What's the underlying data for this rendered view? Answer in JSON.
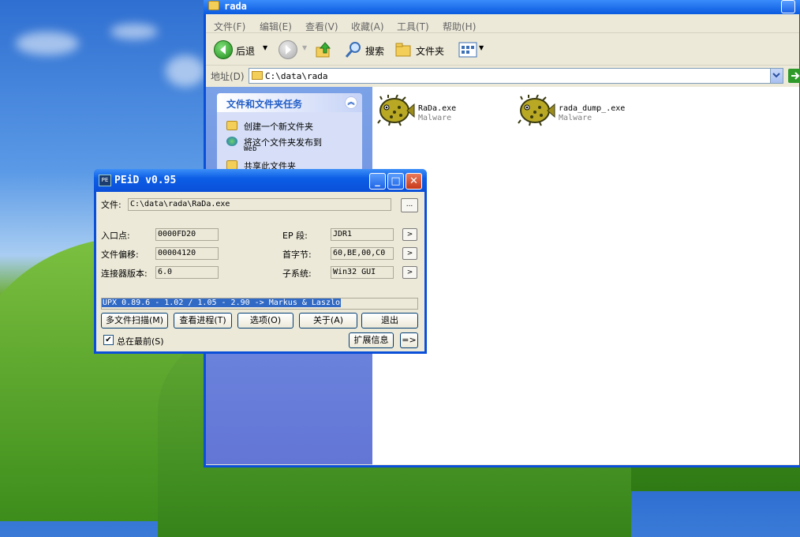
{
  "explorer": {
    "title": "rada",
    "menu": [
      "文件(F)",
      "编辑(E)",
      "查看(V)",
      "收藏(A)",
      "工具(T)",
      "帮助(H)"
    ],
    "toolbar": {
      "back": "后退",
      "search": "搜索",
      "folders": "文件夹"
    },
    "address_label": "地址(D)",
    "address_value": "C:\\data\\rada",
    "tasks_header": "文件和文件夹任务",
    "tasks": [
      "创建一个新文件夹",
      "将这个文件夹发布到",
      "Web",
      "共享此文件夹"
    ],
    "files": [
      {
        "name": "RaDa.exe",
        "type": "Malware"
      },
      {
        "name": "rada_dump_.exe",
        "type": "Malware"
      }
    ]
  },
  "peid": {
    "title": "PEiD v0.95",
    "file_label": "文件:",
    "file_value": "C:\\data\\rada\\RaDa.exe",
    "browse": "...",
    "entry_label": "入口点:",
    "entry_value": "0000FD20",
    "offset_label": "文件偏移:",
    "offset_value": "00004120",
    "linker_label": "连接器版本:",
    "linker_value": "6.0",
    "ep_label": "EP 段:",
    "ep_value": "JDR1",
    "firstbytes_label": "首字节:",
    "firstbytes_value": "60,BE,00,C0",
    "subsystem_label": "子系统:",
    "subsystem_value": "Win32 GUI",
    "signature": "UPX 0.89.6 - 1.02 / 1.05 - 2.90 -> Markus & Laszlo",
    "buttons": {
      "multiscan": "多文件扫描(M)",
      "process": "查看进程(T)",
      "options": "选项(O)",
      "about": "关于(A)",
      "exit": "退出",
      "ext": "扩展信息",
      "more": "=>"
    },
    "stay_on_top": "总在最前(S)",
    "stay_on_top_checked": true
  }
}
